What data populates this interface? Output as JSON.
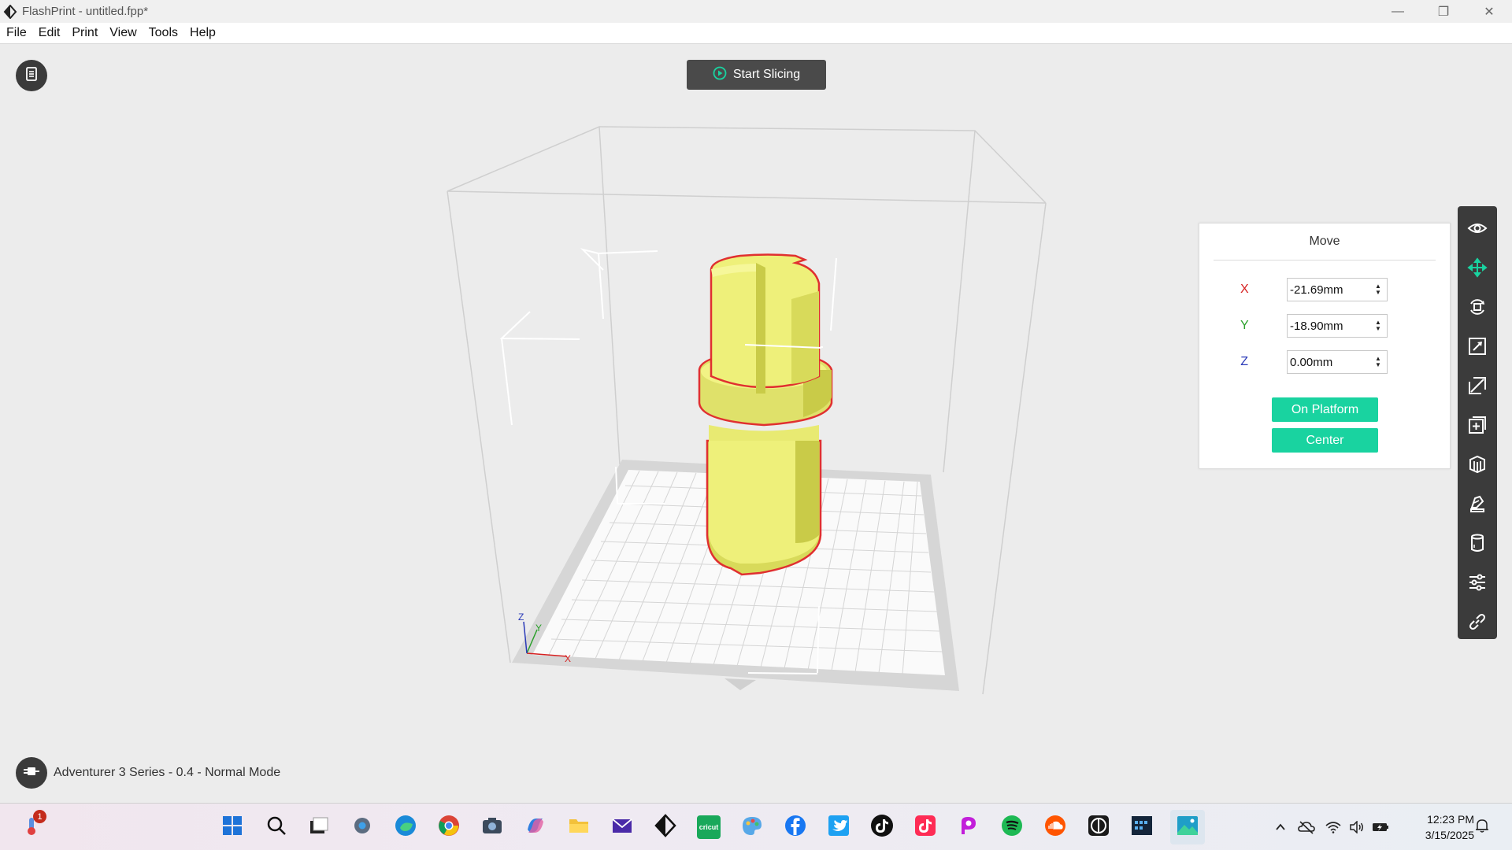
{
  "window": {
    "title": "FlashPrint - untitled.fpp*"
  },
  "menu": [
    "File",
    "Edit",
    "Print",
    "View",
    "Tools",
    "Help"
  ],
  "slice_button": {
    "label": "Start Slicing"
  },
  "move_panel": {
    "title": "Move",
    "x": {
      "label": "X",
      "value": "-21.69mm",
      "color": "#d62020"
    },
    "y": {
      "label": "Y",
      "value": "-18.90mm",
      "color": "#2aa02a"
    },
    "z": {
      "label": "Z",
      "value": "0.00mm",
      "color": "#2a3ab8"
    },
    "on_platform_label": "On Platform",
    "center_label": "Center",
    "accent": "#19d3a0"
  },
  "toolbar_icons": [
    "eye-icon",
    "move-icon",
    "rotate-icon",
    "scale-icon",
    "cut-icon",
    "add-model-icon",
    "supports-icon",
    "extruder-icon",
    "shell-icon",
    "settings-sliders-icon",
    "link-icon"
  ],
  "status": {
    "printer_mode": "Adventurer 3 Series - 0.4 - Normal Mode"
  },
  "model": {
    "fill": "#eef07a",
    "outline": "#e03030"
  },
  "scene_axes": {
    "x": "X",
    "y": "Y",
    "z": "Z"
  },
  "taskbar": {
    "weather_badge": "1",
    "apps": [
      "start-icon",
      "search-icon",
      "task-view-icon",
      "settings-icon",
      "edge-icon",
      "chrome-icon",
      "camera-icon",
      "copilot-icon",
      "file-explorer-icon",
      "mail-icon",
      "flashprint-icon",
      "cricut-icon",
      "paint-icon",
      "facebook-icon",
      "twitter-icon",
      "tiktok-icon",
      "tiktok-alt-icon",
      "picsart-icon",
      "spotify-icon",
      "soundcloud-icon",
      "app-dark-icon",
      "calendar-app-icon",
      "photos-icon"
    ],
    "cricut_text": "cricut",
    "time": "12:23 PM",
    "date": "3/15/2025"
  }
}
